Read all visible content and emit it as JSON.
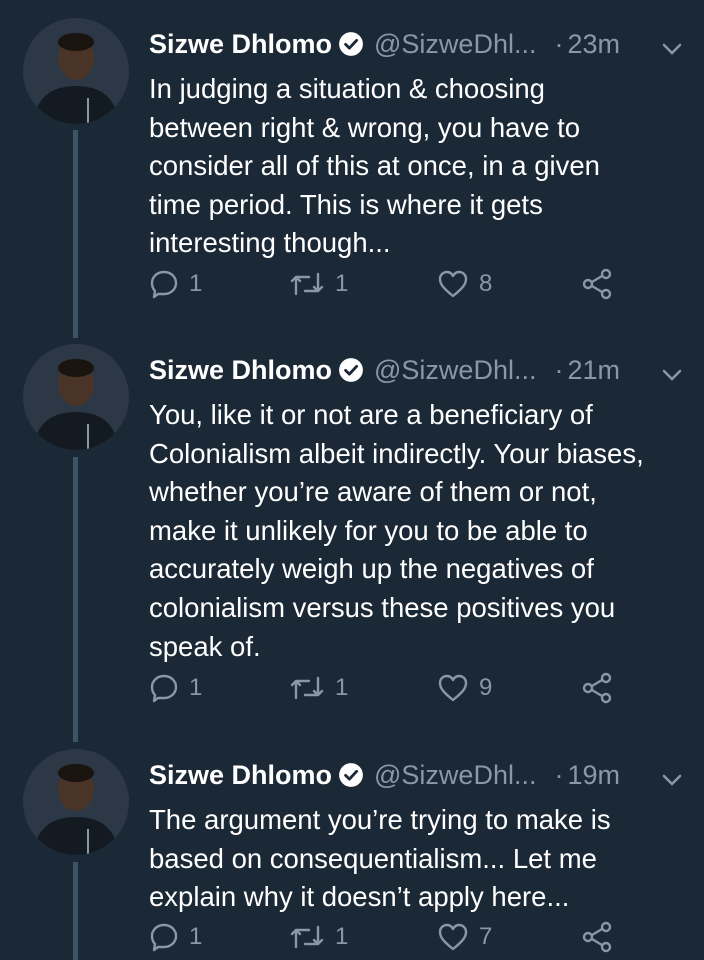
{
  "colors": {
    "background": "#1b2836",
    "secondary_text": "#8899a6",
    "verified_badge": "#ffffff",
    "thread_line": "#3d5466"
  },
  "tweets": [
    {
      "name": "Sizwe Dhlomo",
      "handle": "@SizweDhl...",
      "dot": "·",
      "time": "23m",
      "text": "In judging a situation & choosing\nbetween right & wrong, you have to\nconsider all of this at once, in a given\ntime period. This is where it gets\ninteresting though...",
      "replies": "1",
      "retweets": "1",
      "likes": "8"
    },
    {
      "name": "Sizwe Dhlomo",
      "handle": "@SizweDhl...",
      "dot": "·",
      "time": "21m",
      "text": "You, like it or not are a beneficiary of\nColonialism albeit indirectly. Your biases,\nwhether you’re aware of them or not,\nmake it unlikely for you to be able to\naccurately weigh up the negatives of\ncolonialism versus these positives you\nspeak of.",
      "replies": "1",
      "retweets": "1",
      "likes": "9"
    },
    {
      "name": "Sizwe Dhlomo",
      "handle": "@SizweDhl...",
      "dot": "·",
      "time": "19m",
      "text": "The argument you’re trying to make is\nbased on consequentialism... Let me\nexplain why it doesn’t apply here...",
      "replies": "1",
      "retweets": "1",
      "likes": "7"
    }
  ],
  "icons": {
    "verified": "verified-badge-icon",
    "more": "chevron-down-icon",
    "reply": "reply-icon",
    "retweet": "retweet-icon",
    "like": "heart-icon",
    "share": "share-icon"
  }
}
